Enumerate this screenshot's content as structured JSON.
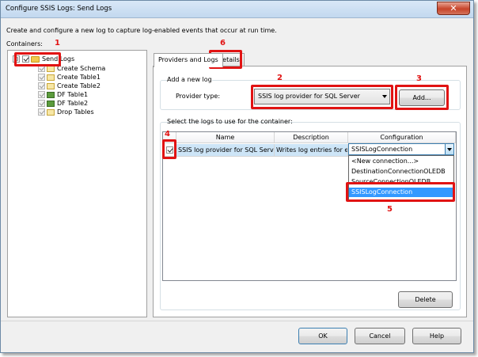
{
  "window": {
    "title": "Configure SSIS Logs: Send Logs",
    "close_glyph": "✕"
  },
  "description": "Create and configure a new log to capture log-enabled events that occur at run time.",
  "containers_label": "Containers:",
  "tree": {
    "root": {
      "expander": "⊟",
      "label": "Send Logs",
      "checked": true
    },
    "children": [
      {
        "label": "Create Schema",
        "icon": "sql-task-icon"
      },
      {
        "label": "Create Table1",
        "icon": "sql-task-icon"
      },
      {
        "label": "Create Table2",
        "icon": "sql-task-icon"
      },
      {
        "label": "DF Table1",
        "icon": "data-flow-icon"
      },
      {
        "label": "DF Table2",
        "icon": "data-flow-icon"
      },
      {
        "label": "Drop Tables",
        "icon": "sql-task-icon"
      }
    ]
  },
  "tabs": [
    {
      "label": "Providers and Logs",
      "active": true
    },
    {
      "label": "Details",
      "active": false
    }
  ],
  "add_log": {
    "group_title": "Add a new log",
    "provider_label": "Provider type:",
    "provider_value": "SSIS log provider for SQL Server",
    "add_button": "Add..."
  },
  "select_logs_label": "Select the logs to use for the container:",
  "grid": {
    "columns": [
      "Name",
      "Description",
      "Configuration"
    ],
    "rows": [
      {
        "checked": true,
        "name": "SSIS log provider for SQL Server",
        "description": "Writes log entries for ev...",
        "configuration": "SSISLogConnection"
      }
    ]
  },
  "configuration_options": [
    "<New connection...>",
    "DestinationConnectionOLEDB",
    "SourceConnectionOLEDB",
    "SSISLogConnection"
  ],
  "highlighted_option": "SSISLogConnection",
  "buttons": {
    "delete": "Delete",
    "ok": "OK",
    "cancel": "Cancel",
    "help": "Help"
  },
  "annotations": [
    "1",
    "2",
    "3",
    "4",
    "5",
    "6"
  ],
  "colors": {
    "annotation_red": "#e11313",
    "selection_blue": "#3399ff"
  }
}
